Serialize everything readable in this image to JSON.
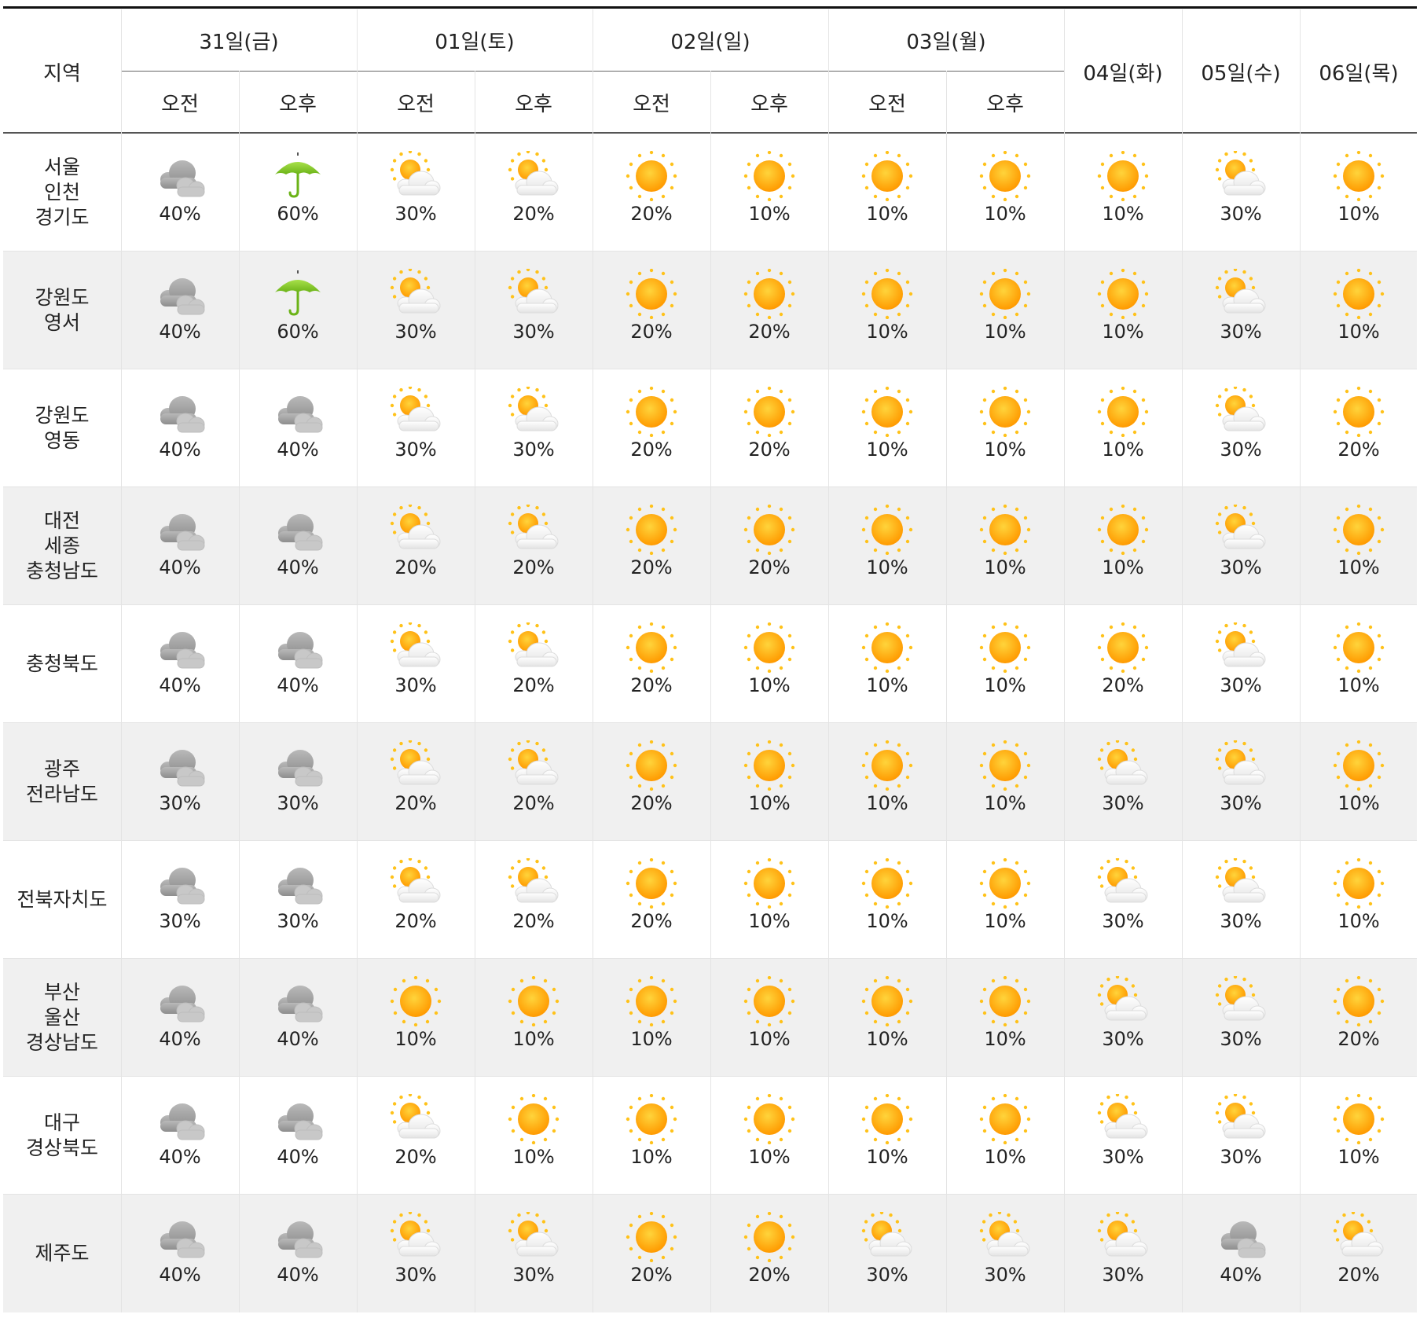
{
  "header": {
    "region_label": "지역",
    "days": [
      {
        "label": "31일(금)",
        "split": true
      },
      {
        "label": "01일(토)",
        "split": true
      },
      {
        "label": "02일(일)",
        "split": true
      },
      {
        "label": "03일(월)",
        "split": true
      },
      {
        "label": "04일(화)",
        "split": false
      },
      {
        "label": "05일(수)",
        "split": false
      },
      {
        "label": "06일(목)",
        "split": false
      }
    ],
    "am_label": "오전",
    "pm_label": "오후"
  },
  "icon_legend": {
    "sun": "sun-icon",
    "partly": "partly-cloudy-icon",
    "cloud": "cloudy-icon",
    "rain": "umbrella-icon"
  },
  "colors": {
    "sun": "#ffa800",
    "umbrella": "#7cc61e",
    "row_shade": "#f0f0f0"
  },
  "rows": [
    {
      "region": [
        "서울",
        "인천",
        "경기도"
      ],
      "cells": [
        [
          "cloud",
          "40%"
        ],
        [
          "rain",
          "60%"
        ],
        [
          "partly",
          "30%"
        ],
        [
          "partly",
          "20%"
        ],
        [
          "sun",
          "20%"
        ],
        [
          "sun",
          "10%"
        ],
        [
          "sun",
          "10%"
        ],
        [
          "sun",
          "10%"
        ],
        [
          "sun",
          "10%"
        ],
        [
          "partly",
          "30%"
        ],
        [
          "sun",
          "10%"
        ]
      ]
    },
    {
      "region": [
        "강원도",
        "영서"
      ],
      "cells": [
        [
          "cloud",
          "40%"
        ],
        [
          "rain",
          "60%"
        ],
        [
          "partly",
          "30%"
        ],
        [
          "partly",
          "30%"
        ],
        [
          "sun",
          "20%"
        ],
        [
          "sun",
          "20%"
        ],
        [
          "sun",
          "10%"
        ],
        [
          "sun",
          "10%"
        ],
        [
          "sun",
          "10%"
        ],
        [
          "partly",
          "30%"
        ],
        [
          "sun",
          "10%"
        ]
      ]
    },
    {
      "region": [
        "강원도",
        "영동"
      ],
      "cells": [
        [
          "cloud",
          "40%"
        ],
        [
          "cloud",
          "40%"
        ],
        [
          "partly",
          "30%"
        ],
        [
          "partly",
          "30%"
        ],
        [
          "sun",
          "20%"
        ],
        [
          "sun",
          "20%"
        ],
        [
          "sun",
          "10%"
        ],
        [
          "sun",
          "10%"
        ],
        [
          "sun",
          "10%"
        ],
        [
          "partly",
          "30%"
        ],
        [
          "sun",
          "20%"
        ]
      ]
    },
    {
      "region": [
        "대전",
        "세종",
        "충청남도"
      ],
      "cells": [
        [
          "cloud",
          "40%"
        ],
        [
          "cloud",
          "40%"
        ],
        [
          "partly",
          "20%"
        ],
        [
          "partly",
          "20%"
        ],
        [
          "sun",
          "20%"
        ],
        [
          "sun",
          "20%"
        ],
        [
          "sun",
          "10%"
        ],
        [
          "sun",
          "10%"
        ],
        [
          "sun",
          "10%"
        ],
        [
          "partly",
          "30%"
        ],
        [
          "sun",
          "10%"
        ]
      ]
    },
    {
      "region": [
        "충청북도"
      ],
      "cells": [
        [
          "cloud",
          "40%"
        ],
        [
          "cloud",
          "40%"
        ],
        [
          "partly",
          "30%"
        ],
        [
          "partly",
          "20%"
        ],
        [
          "sun",
          "20%"
        ],
        [
          "sun",
          "10%"
        ],
        [
          "sun",
          "10%"
        ],
        [
          "sun",
          "10%"
        ],
        [
          "sun",
          "20%"
        ],
        [
          "partly",
          "30%"
        ],
        [
          "sun",
          "10%"
        ]
      ]
    },
    {
      "region": [
        "광주",
        "전라남도"
      ],
      "cells": [
        [
          "cloud",
          "30%"
        ],
        [
          "cloud",
          "30%"
        ],
        [
          "partly",
          "20%"
        ],
        [
          "partly",
          "20%"
        ],
        [
          "sun",
          "20%"
        ],
        [
          "sun",
          "10%"
        ],
        [
          "sun",
          "10%"
        ],
        [
          "sun",
          "10%"
        ],
        [
          "partly",
          "30%"
        ],
        [
          "partly",
          "30%"
        ],
        [
          "sun",
          "10%"
        ]
      ]
    },
    {
      "region": [
        "전북자치도"
      ],
      "cells": [
        [
          "cloud",
          "30%"
        ],
        [
          "cloud",
          "30%"
        ],
        [
          "partly",
          "20%"
        ],
        [
          "partly",
          "20%"
        ],
        [
          "sun",
          "20%"
        ],
        [
          "sun",
          "10%"
        ],
        [
          "sun",
          "10%"
        ],
        [
          "sun",
          "10%"
        ],
        [
          "partly",
          "30%"
        ],
        [
          "partly",
          "30%"
        ],
        [
          "sun",
          "10%"
        ]
      ]
    },
    {
      "region": [
        "부산",
        "울산",
        "경상남도"
      ],
      "cells": [
        [
          "cloud",
          "40%"
        ],
        [
          "cloud",
          "40%"
        ],
        [
          "sun",
          "10%"
        ],
        [
          "sun",
          "10%"
        ],
        [
          "sun",
          "10%"
        ],
        [
          "sun",
          "10%"
        ],
        [
          "sun",
          "10%"
        ],
        [
          "sun",
          "10%"
        ],
        [
          "partly",
          "30%"
        ],
        [
          "partly",
          "30%"
        ],
        [
          "sun",
          "20%"
        ]
      ]
    },
    {
      "region": [
        "대구",
        "경상북도"
      ],
      "cells": [
        [
          "cloud",
          "40%"
        ],
        [
          "cloud",
          "40%"
        ],
        [
          "partly",
          "20%"
        ],
        [
          "sun",
          "10%"
        ],
        [
          "sun",
          "10%"
        ],
        [
          "sun",
          "10%"
        ],
        [
          "sun",
          "10%"
        ],
        [
          "sun",
          "10%"
        ],
        [
          "partly",
          "30%"
        ],
        [
          "partly",
          "30%"
        ],
        [
          "sun",
          "10%"
        ]
      ]
    },
    {
      "region": [
        "제주도"
      ],
      "cells": [
        [
          "cloud",
          "40%"
        ],
        [
          "cloud",
          "40%"
        ],
        [
          "partly",
          "30%"
        ],
        [
          "partly",
          "30%"
        ],
        [
          "sun",
          "20%"
        ],
        [
          "sun",
          "20%"
        ],
        [
          "partly",
          "30%"
        ],
        [
          "partly",
          "30%"
        ],
        [
          "partly",
          "30%"
        ],
        [
          "cloud",
          "40%"
        ],
        [
          "partly",
          "20%"
        ]
      ]
    }
  ]
}
